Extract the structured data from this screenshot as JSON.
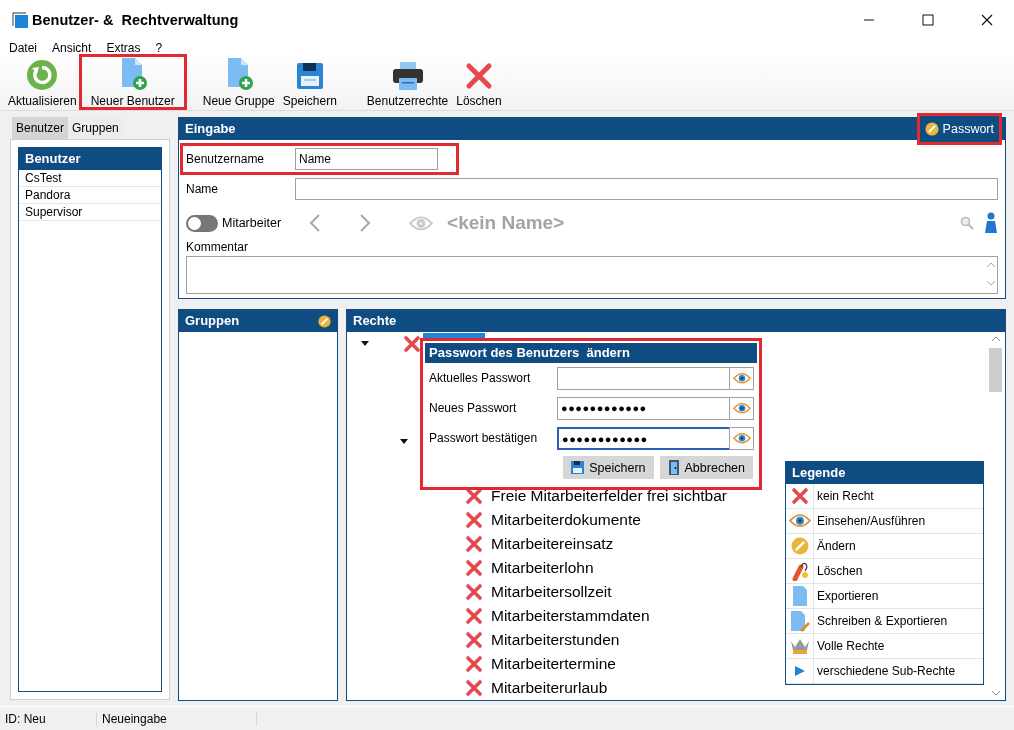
{
  "window": {
    "title": "Benutzer- &  Rechtverwaltung"
  },
  "menu": [
    "Datei",
    "Ansicht",
    "Extras",
    "?"
  ],
  "toolbar": [
    {
      "kind": "refresh",
      "label": "Aktualisieren",
      "highlighted": false
    },
    {
      "kind": "new-user",
      "label": "Neuer Benutzer",
      "highlighted": true
    },
    {
      "kind": "new-group",
      "label": "Neue Gruppe",
      "highlighted": false
    },
    {
      "kind": "save",
      "label": "Speichern",
      "highlighted": false
    },
    {
      "kind": "print",
      "label": "Benutzerrechte",
      "highlighted": false
    },
    {
      "kind": "delete",
      "label": "Löschen",
      "highlighted": false
    }
  ],
  "sidebar": {
    "tabs": [
      {
        "label": "Benutzer",
        "selected": true
      },
      {
        "label": "Gruppen",
        "selected": false
      }
    ],
    "list_title": "Benutzer",
    "items": [
      {
        "label": "CsTest",
        "selected": false
      },
      {
        "label": "Pandora",
        "selected": false
      },
      {
        "label": "Supervisor",
        "selected": false
      }
    ]
  },
  "input_panel": {
    "title": "Eingabe",
    "password_button": {
      "label": "Passwort",
      "highlighted": true
    },
    "username": {
      "label": "Benutzername",
      "value": "Name",
      "highlighted": true
    },
    "name": {
      "label": "Name"
    },
    "employee_toggle": {
      "label": "Mitarbeiter",
      "on": false
    },
    "display_name": "<kein Name>",
    "comment": {
      "label": "Kommentar"
    }
  },
  "groups_panel": {
    "title": "Gruppen"
  },
  "rights_panel": {
    "title": "Rechte",
    "tree": [
      {
        "kind": "denied",
        "selected": true,
        "expanded": true,
        "children": [
          {
            "expanded": true,
            "children": [
              {
                "kind": "denied",
                "label": "Freie Mitarbeiterfelder frei sichtbar"
              },
              {
                "kind": "denied",
                "label": "Mitarbeiterdokumente"
              },
              {
                "kind": "denied",
                "label": "Mitarbeitereinsatz"
              },
              {
                "kind": "denied",
                "label": "Mitarbeiterlohn"
              },
              {
                "kind": "denied",
                "label": "Mitarbeitersollzeit"
              },
              {
                "kind": "denied",
                "label": "Mitarbeiterstammdaten"
              },
              {
                "kind": "denied",
                "label": "Mitarbeiterstunden"
              },
              {
                "kind": "denied",
                "label": "Mitarbeitertermine"
              },
              {
                "kind": "denied",
                "label": "Mitarbeiterurlaub"
              }
            ]
          }
        ]
      }
    ]
  },
  "password_dialog": {
    "title": "Passwort des Benutzers  ändern",
    "highlighted": true,
    "fields": [
      {
        "label": "Aktuelles Passwort",
        "focused": false
      },
      {
        "label": "Neues Passwort",
        "value": "●●●●●●●●●●●●",
        "focused": false
      },
      {
        "label": "Passwort bestätigen",
        "value": "●●●●●●●●●●●●",
        "focused": true
      }
    ],
    "buttons": [
      {
        "kind": "save",
        "label": "Speichern"
      },
      {
        "kind": "cancel",
        "label": "Abbrechen"
      }
    ]
  },
  "legend": {
    "title": "Legende",
    "items": [
      {
        "kind": "none",
        "label": "kein Recht"
      },
      {
        "kind": "view",
        "label": "Einsehen/Ausführen"
      },
      {
        "kind": "edit",
        "label": "Ändern"
      },
      {
        "kind": "delete",
        "label": "Löschen"
      },
      {
        "kind": "export",
        "label": "Exportieren"
      },
      {
        "kind": "write-export",
        "label": "Schreiben & Exportieren"
      },
      {
        "kind": "full",
        "label": "Volle Rechte"
      },
      {
        "kind": "mixed",
        "label": "verschiedene Sub-Rechte"
      }
    ]
  },
  "status_bar": [
    "ID: Neu",
    "Neueingabe"
  ]
}
